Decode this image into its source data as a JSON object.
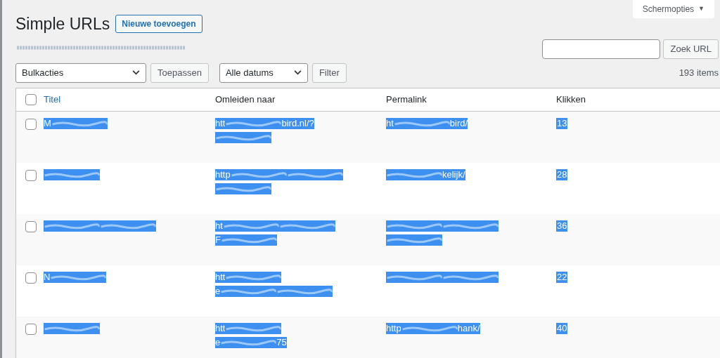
{
  "screen_options": {
    "label": "Schermopties",
    "caret": "▼"
  },
  "page_title": "Simple URLs",
  "add_new_button": "Nieuwe toevoegen",
  "search": {
    "button": "Zoek URL"
  },
  "bulk_actions": {
    "value": "Bulkacties",
    "apply": "Toepassen"
  },
  "date_filter": {
    "value": "Alle datums",
    "apply": "Filter"
  },
  "item_count": "193 items",
  "table": {
    "select_all": {
      "checked": false
    },
    "columns": [
      {
        "label": "Titel",
        "sortable": true
      },
      {
        "label": "Omleiden naar",
        "sortable": false
      },
      {
        "label": "Permalink",
        "sortable": false
      },
      {
        "label": "Klikken",
        "sortable": false
      }
    ],
    "rows": [
      {
        "checked": false,
        "title": [
          [
            {
              "kind": "text",
              "text": "M"
            },
            {
              "kind": "smear"
            }
          ]
        ],
        "redirect": [
          [
            {
              "kind": "text",
              "text": "htt"
            },
            {
              "kind": "smear"
            },
            {
              "kind": "text",
              "text": "bird.nl/?"
            }
          ],
          [
            {
              "kind": "smear"
            }
          ]
        ],
        "permalink": [
          [
            {
              "kind": "text",
              "text": "ht"
            },
            {
              "kind": "smear"
            },
            {
              "kind": "text",
              "text": "bird/"
            }
          ]
        ],
        "clicks": "13"
      },
      {
        "checked": false,
        "title": [
          [
            {
              "kind": "smear"
            }
          ]
        ],
        "redirect": [
          [
            {
              "kind": "text",
              "text": "http"
            },
            {
              "kind": "smear"
            },
            {
              "kind": "smear"
            }
          ],
          [
            {
              "kind": "smear"
            }
          ]
        ],
        "permalink": [
          [
            {
              "kind": "smear"
            },
            {
              "kind": "text",
              "text": "kelijk/"
            }
          ]
        ],
        "clicks": "28"
      },
      {
        "checked": false,
        "title": [
          [
            {
              "kind": "smear"
            },
            {
              "kind": "smear"
            }
          ]
        ],
        "redirect": [
          [
            {
              "kind": "text",
              "text": "ht"
            },
            {
              "kind": "smear"
            },
            {
              "kind": "smear"
            }
          ],
          [
            {
              "kind": "text",
              "text": "F"
            },
            {
              "kind": "smear"
            }
          ]
        ],
        "permalink": [
          [
            {
              "kind": "smear"
            },
            {
              "kind": "smear"
            }
          ],
          [
            {
              "kind": "smear"
            }
          ]
        ],
        "clicks": "36"
      },
      {
        "checked": false,
        "title": [
          [
            {
              "kind": "text",
              "text": "N"
            },
            {
              "kind": "smear"
            }
          ]
        ],
        "redirect": [
          [
            {
              "kind": "text",
              "text": "htt"
            },
            {
              "kind": "smear"
            }
          ],
          [
            {
              "kind": "text",
              "text": "e"
            },
            {
              "kind": "smear"
            },
            {
              "kind": "smear"
            }
          ]
        ],
        "permalink": [
          [
            {
              "kind": "smear"
            },
            {
              "kind": "smear"
            }
          ]
        ],
        "clicks": "22"
      },
      {
        "checked": false,
        "title": [
          [
            {
              "kind": "smear"
            }
          ]
        ],
        "redirect": [
          [
            {
              "kind": "text",
              "text": "htt"
            },
            {
              "kind": "smear"
            }
          ],
          [
            {
              "kind": "text",
              "text": "e"
            },
            {
              "kind": "smear"
            },
            {
              "kind": "text",
              "text": "75"
            }
          ]
        ],
        "permalink": [
          [
            {
              "kind": "text",
              "text": "http"
            },
            {
              "kind": "smear"
            },
            {
              "kind": "text",
              "text": "hank/"
            }
          ]
        ],
        "clicks": "40"
      }
    ]
  }
}
